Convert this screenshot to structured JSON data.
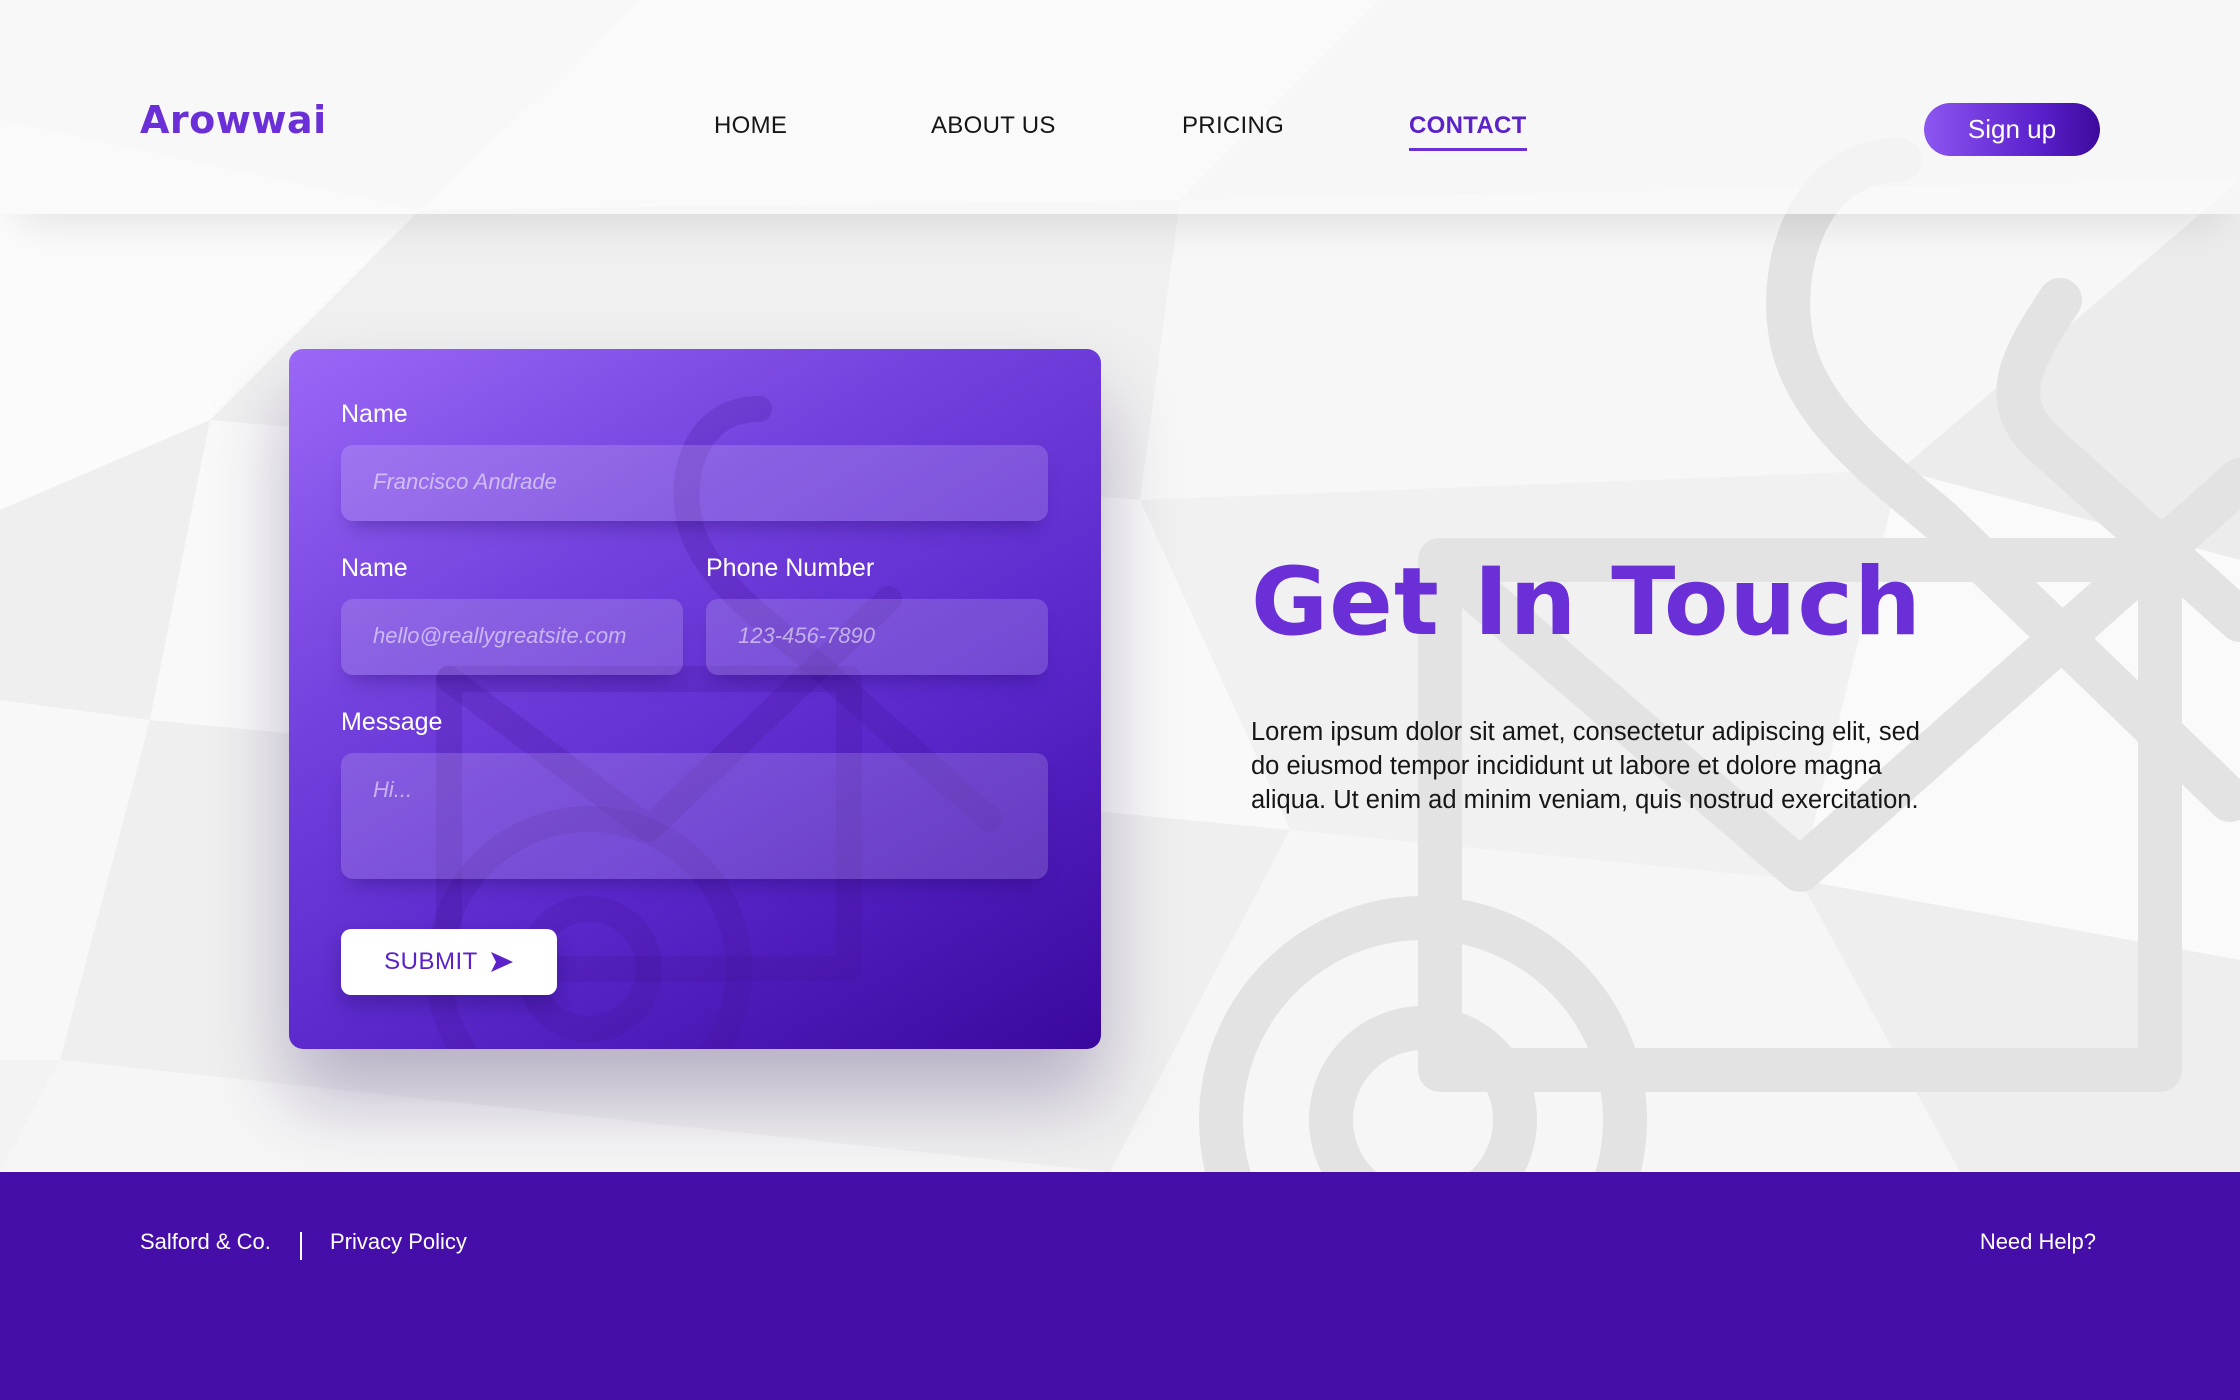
{
  "brand": {
    "name": "Arowwai"
  },
  "nav": {
    "items": [
      {
        "label": "HOME"
      },
      {
        "label": "ABOUT US"
      },
      {
        "label": "PRICING"
      },
      {
        "label": "CONTACT",
        "active": true
      }
    ],
    "signup_label": "Sign up"
  },
  "form": {
    "name_label": "Name",
    "name_placeholder": "Francisco Andrade",
    "email_label": "Name",
    "email_placeholder": "hello@reallygreatsite.com",
    "phone_label": "Phone Number",
    "phone_placeholder": "123-456-7890",
    "message_label": "Message",
    "message_placeholder": "Hi...",
    "submit_label": "SUBMIT",
    "submit_icon": "send-arrow-icon"
  },
  "hero": {
    "title": "Get In Touch",
    "body": "Lorem ipsum dolor sit amet, consectetur adipiscing elit, sed do eiusmod tempor incididunt ut labore et dolore magna aliqua. Ut enim ad minim veniam, quis nostrud exercitation."
  },
  "footer": {
    "company": "Salford & Co.",
    "privacy": "Privacy Policy",
    "help": "Need Help?"
  },
  "colors": {
    "accent": "#6a2fd6",
    "footer_bg": "#460ea8",
    "card_gradient_start": "#9a67f6",
    "card_gradient_end": "#3a079e",
    "background": "#f6f6f6"
  }
}
